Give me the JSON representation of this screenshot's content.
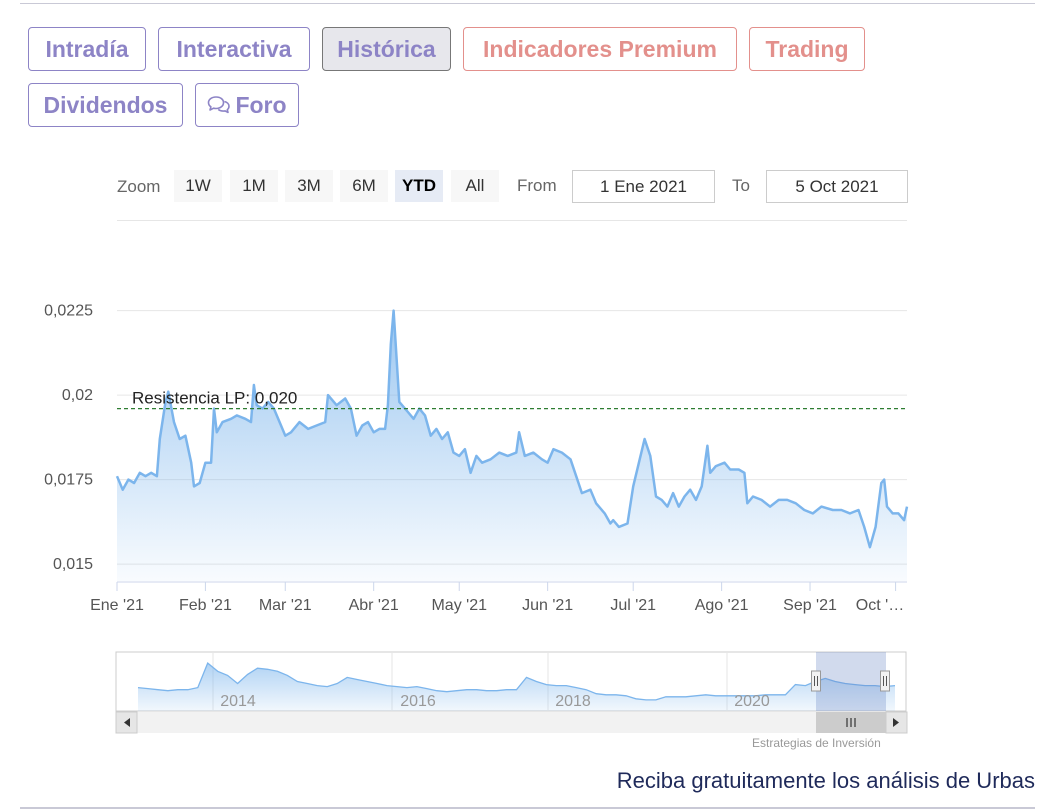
{
  "tabs": [
    {
      "id": "intradia",
      "label": "Intradía",
      "active": false,
      "style": "normal"
    },
    {
      "id": "interactiva",
      "label": "Interactiva",
      "active": false,
      "style": "normal"
    },
    {
      "id": "historica",
      "label": "Histórica",
      "active": true,
      "style": "normal"
    },
    {
      "id": "indicadores",
      "label": "Indicadores Premium",
      "active": false,
      "style": "premium"
    },
    {
      "id": "trading",
      "label": "Trading",
      "active": false,
      "style": "premium"
    },
    {
      "id": "dividendos",
      "label": "Dividendos",
      "active": false,
      "style": "normal"
    },
    {
      "id": "foro",
      "label": "Foro",
      "active": false,
      "style": "normal",
      "icon": "chat-bubbles-icon"
    }
  ],
  "range_selector": {
    "zoom_label": "Zoom",
    "buttons": [
      "1W",
      "1M",
      "3M",
      "6M",
      "YTD",
      "All"
    ],
    "selected": "YTD",
    "from_label": "From",
    "from_value": "1 Ene 2021",
    "to_label": "To",
    "to_value": "5 Oct 2021"
  },
  "chart_data": {
    "type": "area",
    "title": "",
    "ylim": [
      0.0145,
      0.0232
    ],
    "y_ticks": [
      "0,015",
      "0,0175",
      "0,02",
      "0,0225"
    ],
    "y_tick_values": [
      0.015,
      0.0175,
      0.02,
      0.0225
    ],
    "x_labels": [
      "Ene '21",
      "Feb '21",
      "Mar '21",
      "Abr '21",
      "May '21",
      "Jun '21",
      "Jul '21",
      "Ago '21",
      "Sep '21",
      "Oct '…"
    ],
    "x_label_dates": [
      "2021-01-01",
      "2021-02-01",
      "2021-03-01",
      "2021-04-01",
      "2021-05-01",
      "2021-06-01",
      "2021-07-01",
      "2021-08-01",
      "2021-09-01",
      "2021-10-01"
    ],
    "x_range": [
      "2021-01-01",
      "2021-10-05"
    ],
    "series": [
      {
        "name": "",
        "color": "#7cb5ec",
        "points": [
          [
            "2021-01-01",
            0.0176
          ],
          [
            "2021-01-03",
            0.0172
          ],
          [
            "2021-01-05",
            0.0175
          ],
          [
            "2021-01-07",
            0.0174
          ],
          [
            "2021-01-09",
            0.0177
          ],
          [
            "2021-01-11",
            0.0176
          ],
          [
            "2021-01-13",
            0.0177
          ],
          [
            "2021-01-15",
            0.0176
          ],
          [
            "2021-01-16",
            0.0187
          ],
          [
            "2021-01-18",
            0.0198
          ],
          [
            "2021-01-19",
            0.0201
          ],
          [
            "2021-01-21",
            0.0192
          ],
          [
            "2021-01-23",
            0.0187
          ],
          [
            "2021-01-25",
            0.0188
          ],
          [
            "2021-01-27",
            0.018
          ],
          [
            "2021-01-28",
            0.0173
          ],
          [
            "2021-01-30",
            0.0174
          ],
          [
            "2021-02-01",
            0.018
          ],
          [
            "2021-02-03",
            0.018
          ],
          [
            "2021-02-04",
            0.0196
          ],
          [
            "2021-02-05",
            0.0189
          ],
          [
            "2021-02-07",
            0.0192
          ],
          [
            "2021-02-10",
            0.0193
          ],
          [
            "2021-02-12",
            0.0194
          ],
          [
            "2021-02-15",
            0.0193
          ],
          [
            "2021-02-17",
            0.0192
          ],
          [
            "2021-02-18",
            0.0203
          ],
          [
            "2021-02-19",
            0.0197
          ],
          [
            "2021-02-21",
            0.0196
          ],
          [
            "2021-02-23",
            0.0198
          ],
          [
            "2021-02-25",
            0.0196
          ],
          [
            "2021-02-27",
            0.0192
          ],
          [
            "2021-03-01",
            0.0188
          ],
          [
            "2021-03-03",
            0.0189
          ],
          [
            "2021-03-06",
            0.0192
          ],
          [
            "2021-03-09",
            0.019
          ],
          [
            "2021-03-12",
            0.0191
          ],
          [
            "2021-03-15",
            0.0192
          ],
          [
            "2021-03-16",
            0.02
          ],
          [
            "2021-03-19",
            0.0197
          ],
          [
            "2021-03-22",
            0.0199
          ],
          [
            "2021-03-24",
            0.0196
          ],
          [
            "2021-03-26",
            0.0188
          ],
          [
            "2021-03-28",
            0.0191
          ],
          [
            "2021-03-30",
            0.0192
          ],
          [
            "2021-04-01",
            0.0189
          ],
          [
            "2021-04-03",
            0.019
          ],
          [
            "2021-04-05",
            0.019
          ],
          [
            "2021-04-06",
            0.0197
          ],
          [
            "2021-04-07",
            0.0215
          ],
          [
            "2021-04-08",
            0.0225
          ],
          [
            "2021-04-10",
            0.0198
          ],
          [
            "2021-04-13",
            0.0195
          ],
          [
            "2021-04-15",
            0.0193
          ],
          [
            "2021-04-17",
            0.0196
          ],
          [
            "2021-04-19",
            0.0194
          ],
          [
            "2021-04-21",
            0.0188
          ],
          [
            "2021-04-23",
            0.019
          ],
          [
            "2021-04-25",
            0.0187
          ],
          [
            "2021-04-27",
            0.0189
          ],
          [
            "2021-04-29",
            0.0183
          ],
          [
            "2021-05-01",
            0.0182
          ],
          [
            "2021-05-03",
            0.0184
          ],
          [
            "2021-05-05",
            0.0177
          ],
          [
            "2021-05-07",
            0.0182
          ],
          [
            "2021-05-09",
            0.018
          ],
          [
            "2021-05-12",
            0.0181
          ],
          [
            "2021-05-15",
            0.0183
          ],
          [
            "2021-05-18",
            0.0182
          ],
          [
            "2021-05-21",
            0.0183
          ],
          [
            "2021-05-22",
            0.0189
          ],
          [
            "2021-05-24",
            0.0182
          ],
          [
            "2021-05-27",
            0.0183
          ],
          [
            "2021-05-30",
            0.0181
          ],
          [
            "2021-06-01",
            0.018
          ],
          [
            "2021-06-03",
            0.0184
          ],
          [
            "2021-06-06",
            0.0183
          ],
          [
            "2021-06-09",
            0.0181
          ],
          [
            "2021-06-11",
            0.0176
          ],
          [
            "2021-06-13",
            0.0171
          ],
          [
            "2021-06-16",
            0.0172
          ],
          [
            "2021-06-18",
            0.0168
          ],
          [
            "2021-06-21",
            0.0165
          ],
          [
            "2021-06-23",
            0.0162
          ],
          [
            "2021-06-24",
            0.0163
          ],
          [
            "2021-06-26",
            0.0161
          ],
          [
            "2021-06-29",
            0.0162
          ],
          [
            "2021-07-01",
            0.0173
          ],
          [
            "2021-07-03",
            0.018
          ],
          [
            "2021-07-05",
            0.0187
          ],
          [
            "2021-07-07",
            0.0182
          ],
          [
            "2021-07-09",
            0.017
          ],
          [
            "2021-07-11",
            0.0169
          ],
          [
            "2021-07-13",
            0.0167
          ],
          [
            "2021-07-15",
            0.0171
          ],
          [
            "2021-07-17",
            0.0167
          ],
          [
            "2021-07-19",
            0.017
          ],
          [
            "2021-07-21",
            0.0172
          ],
          [
            "2021-07-23",
            0.0169
          ],
          [
            "2021-07-25",
            0.0173
          ],
          [
            "2021-07-27",
            0.0185
          ],
          [
            "2021-07-28",
            0.0177
          ],
          [
            "2021-07-30",
            0.0179
          ],
          [
            "2021-08-02",
            0.018
          ],
          [
            "2021-08-04",
            0.0178
          ],
          [
            "2021-08-07",
            0.0178
          ],
          [
            "2021-08-09",
            0.0177
          ],
          [
            "2021-08-10",
            0.0168
          ],
          [
            "2021-08-12",
            0.017
          ],
          [
            "2021-08-15",
            0.0169
          ],
          [
            "2021-08-18",
            0.0167
          ],
          [
            "2021-08-21",
            0.0169
          ],
          [
            "2021-08-24",
            0.0169
          ],
          [
            "2021-08-27",
            0.0168
          ],
          [
            "2021-08-30",
            0.0166
          ],
          [
            "2021-09-02",
            0.0165
          ],
          [
            "2021-09-05",
            0.0167
          ],
          [
            "2021-09-09",
            0.0166
          ],
          [
            "2021-09-12",
            0.0166
          ],
          [
            "2021-09-15",
            0.0165
          ],
          [
            "2021-09-18",
            0.0166
          ],
          [
            "2021-09-20",
            0.0161
          ],
          [
            "2021-09-22",
            0.0155
          ],
          [
            "2021-09-24",
            0.0161
          ],
          [
            "2021-09-26",
            0.0174
          ],
          [
            "2021-09-27",
            0.0175
          ],
          [
            "2021-09-28",
            0.0167
          ],
          [
            "2021-09-30",
            0.0165
          ],
          [
            "2021-10-02",
            0.0165
          ],
          [
            "2021-10-04",
            0.0163
          ],
          [
            "2021-10-05",
            0.0167
          ]
        ]
      }
    ],
    "plot_lines": [
      {
        "label": "Resistencia LP: 0,020",
        "value": 0.0196,
        "color": "#2e7d32",
        "style": "dashed"
      }
    ],
    "grid": true,
    "navigator": {
      "x_labels": [
        "2014",
        "2016",
        "2018",
        "2020"
      ],
      "selected_range": "YTD",
      "series": [
        {
          "name": "",
          "color": "#7cb5ec",
          "values": [
            0.0174,
            0.0173,
            0.0172,
            0.0171,
            0.0172,
            0.0172,
            0.0174,
            0.0198,
            0.019,
            0.0186,
            0.0178,
            0.0187,
            0.0193,
            0.0192,
            0.019,
            0.0186,
            0.018,
            0.0178,
            0.0176,
            0.0175,
            0.0178,
            0.0184,
            0.0182,
            0.018,
            0.0178,
            0.0176,
            0.0175,
            0.0174,
            0.0175,
            0.0173,
            0.0171,
            0.017,
            0.0171,
            0.0172,
            0.0172,
            0.0171,
            0.0171,
            0.0172,
            0.0172,
            0.0184,
            0.018,
            0.0177,
            0.0176,
            0.0176,
            0.0174,
            0.0172,
            0.0168,
            0.0167,
            0.0167,
            0.0166,
            0.0163,
            0.0162,
            0.0162,
            0.0165,
            0.0165,
            0.0165,
            0.0166,
            0.0167,
            0.0166,
            0.0166,
            0.0166,
            0.0166,
            0.0166,
            0.0167,
            0.0167,
            0.0167,
            0.0177,
            0.0176,
            0.018,
            0.0183,
            0.018,
            0.0178,
            0.0177,
            0.0176,
            0.0176,
            0.0175,
            0.0176
          ]
        }
      ]
    }
  },
  "credits": "Estrategias de Inversión",
  "cta_text": "Reciba gratuitamente los análisis de Urbas",
  "colors": {
    "accent": "#8d84c6",
    "premium": "#e3908c",
    "series": "#7cb5ec",
    "resistance": "#2e7d32"
  }
}
